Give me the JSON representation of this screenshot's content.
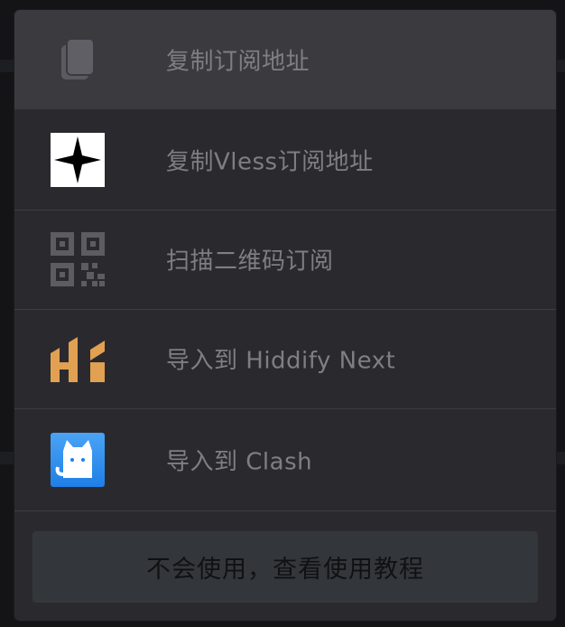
{
  "menu": {
    "items": [
      {
        "label": "复制订阅地址",
        "icon": "copy-icon"
      },
      {
        "label": "复制Vless订阅地址",
        "icon": "vless-star-icon"
      },
      {
        "label": "扫描二维码订阅",
        "icon": "qr-code-icon"
      },
      {
        "label": "导入到 Hiddify Next",
        "icon": "hiddify-icon"
      },
      {
        "label": "导入到 Clash",
        "icon": "clash-cat-icon"
      }
    ],
    "tutorial_label": "不会使用，查看使用教程"
  },
  "colors": {
    "sheet_bg": "#2a2a2e",
    "highlight_bg": "#3a3a3f",
    "label_text": "#7e7e83",
    "hiddify_orange": "#e2a052",
    "clash_blue": "#2d8ef0",
    "tutorial_bg": "#33373b"
  }
}
